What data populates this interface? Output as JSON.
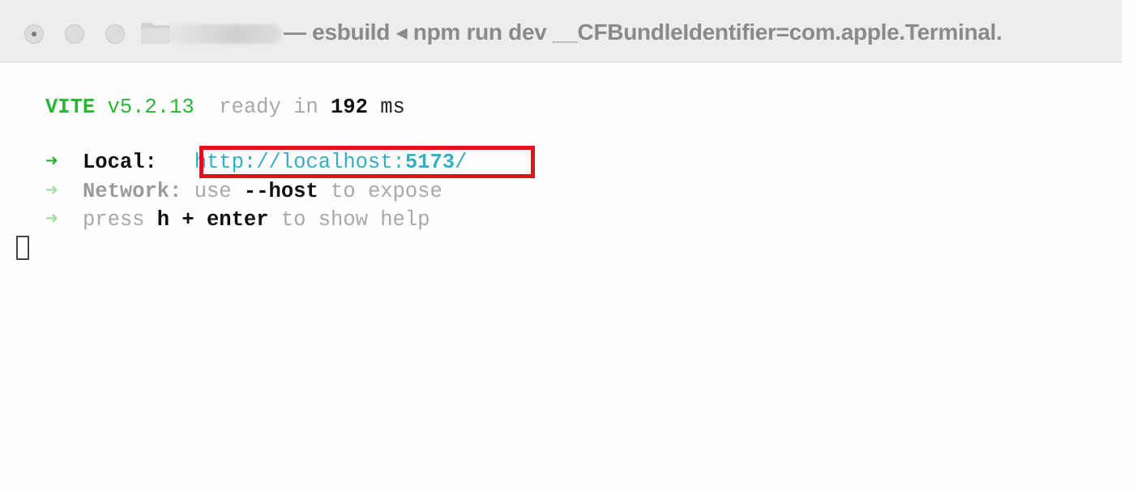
{
  "window": {
    "title": "— esbuild ◂ npm run dev __CFBundleIdentifier=com.apple.Terminal.",
    "icons": [
      "close-light",
      "minimize-light",
      "zoom-light",
      "folder-icon"
    ]
  },
  "terminal": {
    "line1": {
      "app": "VITE",
      "version": " v5.2.13",
      "ready_text": "  ready in ",
      "ready_ms": "192",
      "ms_unit": " ms"
    },
    "local": {
      "arrow": "➜",
      "label": "  Local:   ",
      "url_prefix": "http://localhost:",
      "url_port": "5173",
      "url_suffix": "/"
    },
    "network": {
      "arrow": "➜",
      "label": "  Network:",
      "text_use": " use ",
      "flag": "--host",
      "text_expose": " to expose"
    },
    "help": {
      "arrow": "➜",
      "text_press": "  press ",
      "keys": "h + enter",
      "text_help": " to show help"
    }
  },
  "colors": {
    "vite_green": "#2bb534",
    "url_cyan": "#35aec2",
    "highlight_red": "#e0131b",
    "dim_grey": "#a8a8a8"
  }
}
